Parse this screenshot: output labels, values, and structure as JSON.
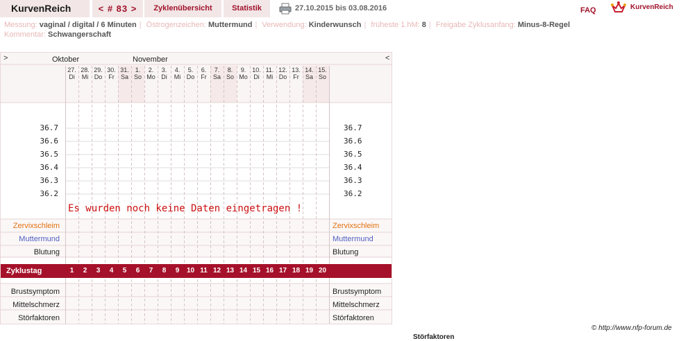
{
  "header": {
    "brand": "KurvenReich",
    "cycle_nav": "< # 83 >",
    "tab_overview": "Zyklenübersicht",
    "tab_stats": "Statistik",
    "date_range": "27.10.2015 bis 03.08.2016",
    "faq": "FAQ",
    "logo_text": "KurvenReich"
  },
  "meta": {
    "messung_label": "Messung:",
    "messung_value": "vaginal / digital / 6 Minuten",
    "oestrogen_label": "Östrogenzeichen:",
    "oestrogen_value": "Muttermund",
    "verwendung_label": "Verwendung:",
    "verwendung_value": "Kinderwunsch",
    "hm_label": "früheste 1.hM:",
    "hm_value": "8",
    "freigabe_label": "Freigabe Zyklusanfang:",
    "freigabe_value": "Minus-8-Regel",
    "kommentar_label": "Kommentar:",
    "kommentar_value": "Schwangerschaft"
  },
  "chart_data": {
    "type": "line",
    "title": "",
    "xlabel": "Zyklustag",
    "ylabel": "",
    "nav_prev": ">",
    "nav_next": "<",
    "months": [
      "Oktober",
      "November"
    ],
    "dates": [
      "27.",
      "28.",
      "29.",
      "30.",
      "31.",
      "1.",
      "2.",
      "3.",
      "4.",
      "5.",
      "6.",
      "7.",
      "8.",
      "9.",
      "10.",
      "11.",
      "12.",
      "13.",
      "14.",
      "15."
    ],
    "weekdays": [
      "Di",
      "Mi",
      "Do",
      "Fr",
      "Sa",
      "So",
      "Mo",
      "Di",
      "Mi",
      "Do",
      "Fr",
      "Sa",
      "So",
      "Mo",
      "Di",
      "Mi",
      "Do",
      "Fr",
      "Sa",
      "So"
    ],
    "cycle_days": [
      "1",
      "2",
      "3",
      "4",
      "5",
      "6",
      "7",
      "8",
      "9",
      "10",
      "11",
      "12",
      "13",
      "14",
      "15",
      "16",
      "17",
      "18",
      "19",
      "20"
    ],
    "y_ticks": [
      "36.7",
      "36.6",
      "36.5",
      "36.4",
      "36.3",
      "36.2"
    ],
    "ylim": [
      36.2,
      36.7
    ],
    "series": [],
    "message": "Es wurden noch keine Daten eingetragen !",
    "rows": {
      "cervix": "Zervixschleim",
      "muttermund": "Muttermund",
      "blutung": "Blutung",
      "zyklustag": "Zyklustag",
      "brust": "Brustsymptom",
      "mittel": "Mittelschmerz",
      "stoer": "Störfaktoren"
    },
    "colors": {
      "accent": "#a5112a",
      "weekend": "#f5e9e9",
      "cervix": "#e07010",
      "muttermund": "#5060c0"
    }
  },
  "footer": {
    "copyright": "© http://www.nfp-forum.de",
    "cutoff": "Störfaktoren"
  }
}
